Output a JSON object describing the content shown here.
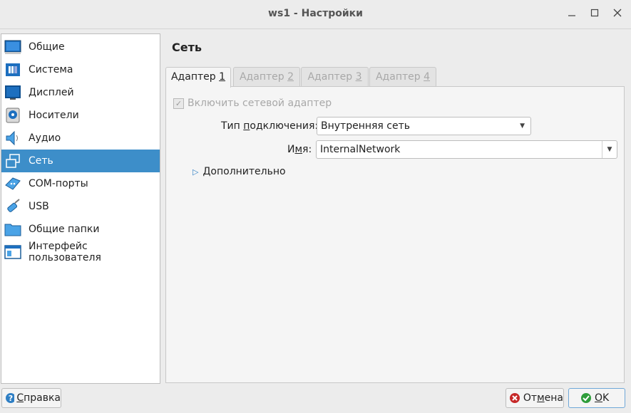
{
  "window": {
    "title": "ws1 - Настройки"
  },
  "sidebar": {
    "items": [
      {
        "label": "Общие",
        "icon": "general-icon",
        "selected": false
      },
      {
        "label": "Система",
        "icon": "system-icon",
        "selected": false
      },
      {
        "label": "Дисплей",
        "icon": "display-icon",
        "selected": false
      },
      {
        "label": "Носители",
        "icon": "storage-icon",
        "selected": false
      },
      {
        "label": "Аудио",
        "icon": "audio-icon",
        "selected": false
      },
      {
        "label": "Сеть",
        "icon": "network-icon",
        "selected": true
      },
      {
        "label": "COM-порты",
        "icon": "serial-ports-icon",
        "selected": false
      },
      {
        "label": "USB",
        "icon": "usb-icon",
        "selected": false
      },
      {
        "label": "Общие папки",
        "icon": "shared-folders-icon",
        "selected": false
      },
      {
        "label": "Интерфейс пользователя",
        "icon": "user-interface-icon",
        "selected": false
      }
    ]
  },
  "page": {
    "title": "Сеть"
  },
  "tabs": [
    {
      "prefix": "Адаптер ",
      "num": "1",
      "active": true
    },
    {
      "prefix": "Адаптер ",
      "num": "2",
      "active": false
    },
    {
      "prefix": "Адаптер ",
      "num": "3",
      "active": false
    },
    {
      "prefix": "Адаптер ",
      "num": "4",
      "active": false
    }
  ],
  "adapter": {
    "enable_label": "Включить сетевой адаптер",
    "enable_checked": true,
    "type_label_a": "Тип ",
    "type_label_u": "п",
    "type_label_b": "одключения:",
    "type_value": "Внутренняя сеть",
    "name_label_a": "И",
    "name_label_u": "м",
    "name_label_b": "я:",
    "name_value": "InternalNetwork",
    "advanced_u": "Д",
    "advanced_rest": "ополнительно"
  },
  "buttons": {
    "help_u": "С",
    "help_rest": "правка",
    "cancel_a": "От",
    "cancel_u": "м",
    "cancel_b": "ена",
    "ok_u": "O",
    "ok_rest": "K"
  },
  "colors": {
    "selection": "#3d8ec9",
    "ok_icon": "#2e9d3a",
    "cancel_icon": "#c62828",
    "help_icon": "#2f7fc4"
  }
}
